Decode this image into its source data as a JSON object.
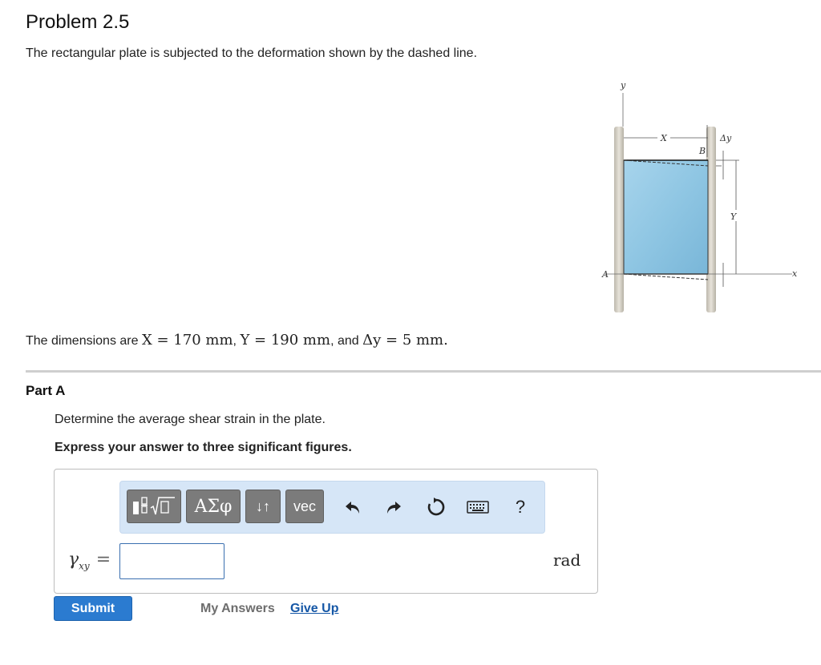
{
  "problem": {
    "title": "Problem 2.5",
    "intro": "The rectangular plate is subjected to the deformation shown by the dashed line.",
    "dims_text": "The dimensions are",
    "dims_X": "X = 170 mm",
    "dims_Y": "Y = 190 mm",
    "dims_and": "and",
    "dims_dy": "Δy = 5 mm",
    "dims_end": "."
  },
  "figure": {
    "label_y_axis": "y",
    "label_x_axis": "x",
    "label_X": "X",
    "label_Y": "Y",
    "label_dy": "Δy",
    "label_A": "A",
    "label_B": "B",
    "plate_color": "#8fc6e3"
  },
  "part": {
    "title": "Part A",
    "question": "Determine the average shear strain in the plate.",
    "instruction": "Express your answer to three significant figures."
  },
  "toolbar": {
    "greek_label": "ΑΣφ",
    "arrows_label": "↓↑",
    "vec_label": "vec",
    "help_label": "?"
  },
  "answer": {
    "symbol": "γ",
    "subscript": "xy",
    "equals": "=",
    "value": "",
    "unit": "rad"
  },
  "actions": {
    "submit_label": "Submit",
    "my_answers_label": "My Answers",
    "give_up_label": "Give Up"
  },
  "colors": {
    "accent": "#2b7bd0",
    "toolbar_bg": "#d6e6f7",
    "link": "#1557a6"
  }
}
